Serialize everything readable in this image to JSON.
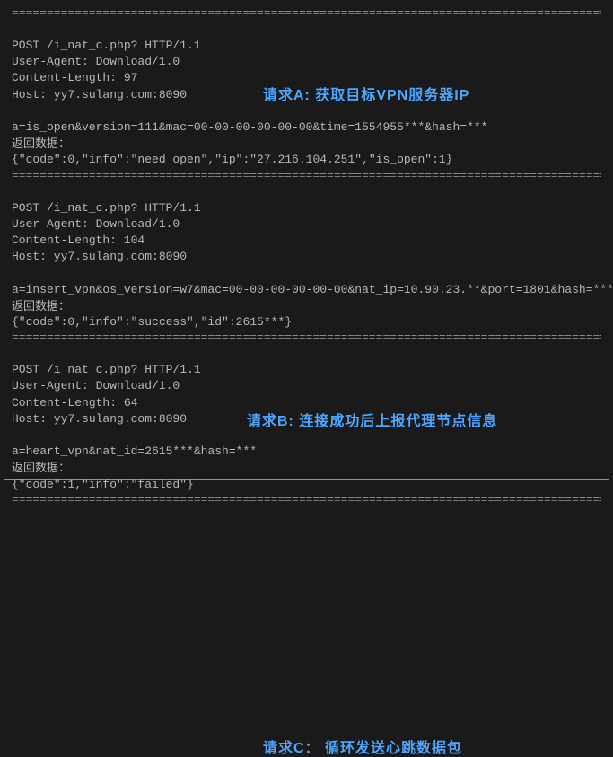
{
  "divider": "=======================================================================================",
  "requests": {
    "a": {
      "annotation": "请求A: 获取目标VPN服务器IP",
      "request_line": "POST /i_nat_c.php? HTTP/1.1",
      "user_agent": "User-Agent: Download/1.0",
      "content_length": "Content-Length: 97",
      "host": "Host: yy7.sulang.com:8090",
      "body": "a=is_open&version=111&mac=00-00-00-00-00-00&time=1554955***&hash=***",
      "response_label": "返回数据：",
      "response": "{\"code\":0,\"info\":\"need open\",\"ip\":\"27.216.104.251\",\"is_open\":1}"
    },
    "b": {
      "annotation": "请求B: 连接成功后上报代理节点信息",
      "request_line": "POST /i_nat_c.php? HTTP/1.1",
      "user_agent": "User-Agent: Download/1.0",
      "content_length": "Content-Length: 104",
      "host": "Host: yy7.sulang.com:8090",
      "body": "a=insert_vpn&os_version=w7&mac=00-00-00-00-00-00&nat_ip=10.90.23.**&port=1801&hash=***",
      "response_label": "返回数据：",
      "response": "{\"code\":0,\"info\":\"success\",\"id\":2615***}"
    },
    "c": {
      "annotation": "请求C： 循环发送心跳数据包",
      "request_line": "POST /i_nat_c.php? HTTP/1.1",
      "user_agent": "User-Agent: Download/1.0",
      "content_length": "Content-Length: 64",
      "host": "Host: yy7.sulang.com:8090",
      "body": "a=heart_vpn&nat_id=2615***&hash=***",
      "response_label": "返回数据：",
      "response": "{\"code\":1,\"info\":\"failed\"}"
    }
  }
}
